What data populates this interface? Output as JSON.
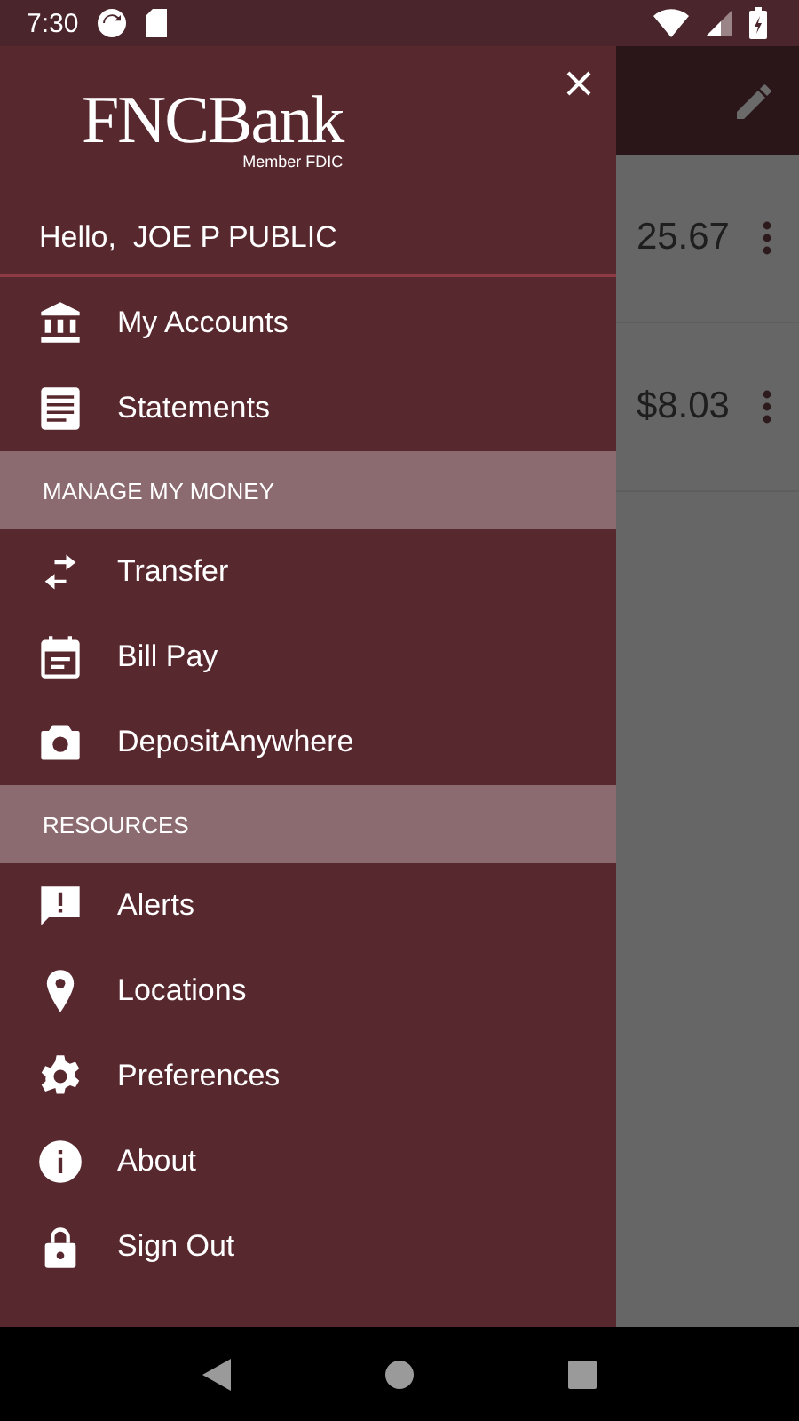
{
  "status_bar": {
    "time": "7:30"
  },
  "background": {
    "rows": [
      {
        "amount": "25.67"
      },
      {
        "amount": "$8.03"
      }
    ]
  },
  "drawer": {
    "logo": {
      "name": "FNCBank",
      "tagline": "Member FDIC"
    },
    "greeting": "Hello,  JOE P PUBLIC",
    "items": [
      {
        "kind": "item",
        "label": "My Accounts"
      },
      {
        "kind": "item",
        "label": "Statements"
      },
      {
        "kind": "section",
        "label": "MANAGE MY MONEY"
      },
      {
        "kind": "item",
        "label": "Transfer"
      },
      {
        "kind": "item",
        "label": "Bill Pay"
      },
      {
        "kind": "item",
        "label": "DepositAnywhere"
      },
      {
        "kind": "section",
        "label": "RESOURCES"
      },
      {
        "kind": "item",
        "label": "Alerts"
      },
      {
        "kind": "item",
        "label": "Locations"
      },
      {
        "kind": "item",
        "label": "Preferences"
      },
      {
        "kind": "item",
        "label": "About"
      },
      {
        "kind": "item",
        "label": "Sign Out"
      }
    ]
  }
}
